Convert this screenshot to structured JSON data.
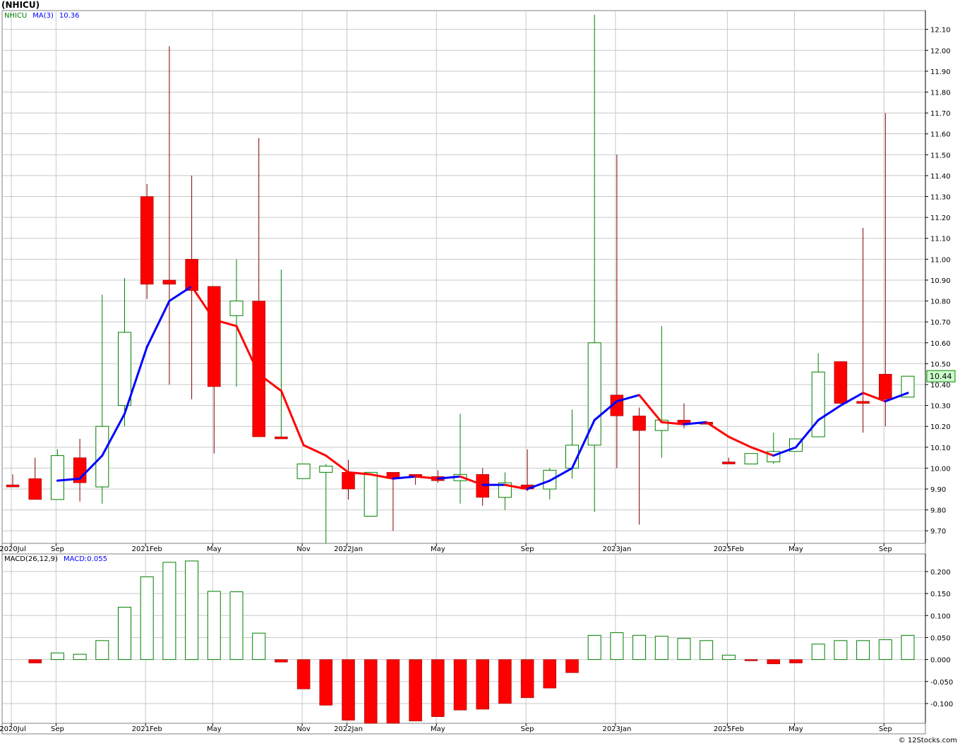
{
  "title": "(NHICU)",
  "credit": "© 12Stocks.com",
  "colors": {
    "up": "#008000",
    "down": "#ff0000",
    "ma_up": "#0000ff",
    "ma_down": "#ff0000",
    "grid": "#c8c8c8",
    "frame": "#808080",
    "price_label_bg": "#ccffcc"
  },
  "chart_data": [
    {
      "type": "candlestick",
      "symbol": "NHICU",
      "legend": {
        "symbol": "NHICU",
        "ma_label": "MA(3)",
        "ma_value": "10.36"
      },
      "last_price_label": "10.44",
      "y_ticks": [
        9.7,
        9.8,
        9.9,
        10.0,
        10.1,
        10.2,
        10.3,
        10.4,
        10.5,
        10.6,
        10.7,
        10.8,
        10.9,
        11.0,
        11.1,
        11.2,
        11.3,
        11.4,
        11.5,
        11.6,
        11.7,
        11.8,
        11.9,
        12.0,
        12.1
      ],
      "y_tick_labels": [
        "9.70",
        "9.80",
        "9.90",
        "10.00",
        "10.10",
        "10.20",
        "10.30",
        "10.40",
        "10.50",
        "10.60",
        "10.70",
        "10.80",
        "10.90",
        "11.00",
        "11.10",
        "11.20",
        "11.30",
        "11.40",
        "11.50",
        "11.60",
        "11.70",
        "11.80",
        "11.90",
        "12.00",
        "12.10"
      ],
      "ylim": [
        9.64,
        12.19
      ],
      "x_labels": [
        {
          "index": 0,
          "label": "2020Jul"
        },
        {
          "index": 2,
          "label": "Sep"
        },
        {
          "index": 6,
          "label": "2021Feb"
        },
        {
          "index": 9,
          "label": "May"
        },
        {
          "index": 13,
          "label": "Nov"
        },
        {
          "index": 15,
          "label": "2022Jan"
        },
        {
          "index": 19,
          "label": "May"
        },
        {
          "index": 23,
          "label": "Sep"
        },
        {
          "index": 27,
          "label": "2023Jan"
        },
        {
          "index": 32,
          "label": "2025Feb"
        },
        {
          "index": 35,
          "label": "May"
        },
        {
          "index": 39,
          "label": "Sep"
        }
      ],
      "candles": [
        {
          "o": 9.92,
          "h": 9.97,
          "l": 9.91,
          "c": 9.91
        },
        {
          "o": 9.95,
          "h": 10.05,
          "l": 9.85,
          "c": 9.85
        },
        {
          "o": 9.85,
          "h": 10.09,
          "l": 9.85,
          "c": 10.06
        },
        {
          "o": 10.05,
          "h": 10.14,
          "l": 9.84,
          "c": 9.93
        },
        {
          "o": 9.91,
          "h": 10.83,
          "l": 9.83,
          "c": 10.2
        },
        {
          "o": 10.3,
          "h": 10.91,
          "l": 10.2,
          "c": 10.65
        },
        {
          "o": 11.3,
          "h": 11.36,
          "l": 10.81,
          "c": 10.88
        },
        {
          "o": 10.9,
          "h": 12.02,
          "l": 10.4,
          "c": 10.88
        },
        {
          "o": 11.0,
          "h": 11.4,
          "l": 10.33,
          "c": 10.85
        },
        {
          "o": 10.87,
          "h": 10.87,
          "l": 10.07,
          "c": 10.39
        },
        {
          "o": 10.73,
          "h": 11.0,
          "l": 10.39,
          "c": 10.8
        },
        {
          "o": 10.8,
          "h": 11.58,
          "l": 10.15,
          "c": 10.15
        },
        {
          "o": 10.15,
          "h": 10.95,
          "l": 10.15,
          "c": 10.15
        },
        {
          "o": 9.95,
          "h": 10.02,
          "l": 9.95,
          "c": 10.02
        },
        {
          "o": 9.98,
          "h": 10.02,
          "l": 9.64,
          "c": 10.01
        },
        {
          "o": 9.98,
          "h": 10.04,
          "l": 9.85,
          "c": 9.9
        },
        {
          "o": 9.77,
          "h": 9.98,
          "l": 9.77,
          "c": 9.98
        },
        {
          "o": 9.98,
          "h": 9.98,
          "l": 9.7,
          "c": 9.95
        },
        {
          "o": 9.97,
          "h": 9.97,
          "l": 9.92,
          "c": 9.96
        },
        {
          "o": 9.96,
          "h": 9.99,
          "l": 9.93,
          "c": 9.94
        },
        {
          "o": 9.94,
          "h": 10.26,
          "l": 9.83,
          "c": 9.97
        },
        {
          "o": 9.97,
          "h": 10.0,
          "l": 9.82,
          "c": 9.86
        },
        {
          "o": 9.86,
          "h": 9.98,
          "l": 9.8,
          "c": 9.93
        },
        {
          "o": 9.92,
          "h": 10.09,
          "l": 9.89,
          "c": 9.9
        },
        {
          "o": 9.9,
          "h": 10.0,
          "l": 9.85,
          "c": 9.99
        },
        {
          "o": 10.0,
          "h": 10.28,
          "l": 9.95,
          "c": 10.11
        },
        {
          "o": 10.11,
          "h": 12.17,
          "l": 9.79,
          "c": 10.6
        },
        {
          "o": 10.35,
          "h": 11.5,
          "l": 10.0,
          "c": 10.25
        },
        {
          "o": 10.25,
          "h": 10.29,
          "l": 9.73,
          "c": 10.18
        },
        {
          "o": 10.18,
          "h": 10.68,
          "l": 10.05,
          "c": 10.23
        },
        {
          "o": 10.23,
          "h": 10.31,
          "l": 10.19,
          "c": 10.21
        },
        {
          "o": 10.22,
          "h": 10.22,
          "l": 10.22,
          "c": 10.22
        },
        {
          "o": 10.03,
          "h": 10.05,
          "l": 10.02,
          "c": 10.02
        },
        {
          "o": 10.02,
          "h": 10.07,
          "l": 10.02,
          "c": 10.07
        },
        {
          "o": 10.03,
          "h": 10.17,
          "l": 10.02,
          "c": 10.08
        },
        {
          "o": 10.08,
          "h": 10.14,
          "l": 10.08,
          "c": 10.14
        },
        {
          "o": 10.15,
          "h": 10.55,
          "l": 10.15,
          "c": 10.46
        },
        {
          "o": 10.51,
          "h": 10.51,
          "l": 10.31,
          "c": 10.31
        },
        {
          "o": 10.32,
          "h": 11.15,
          "l": 10.17,
          "c": 10.31
        },
        {
          "o": 10.45,
          "h": 11.7,
          "l": 10.2,
          "c": 10.33
        },
        {
          "o": 10.34,
          "h": 10.44,
          "l": 10.34,
          "c": 10.44
        }
      ],
      "ma": [
        null,
        null,
        9.94,
        9.95,
        10.06,
        10.26,
        10.58,
        10.8,
        10.87,
        10.71,
        10.68,
        10.45,
        10.37,
        10.11,
        10.06,
        9.98,
        9.97,
        9.95,
        9.96,
        9.95,
        9.96,
        9.92,
        9.92,
        9.9,
        9.94,
        10.0,
        10.23,
        10.32,
        10.35,
        10.22,
        10.21,
        10.22,
        10.15,
        10.1,
        10.06,
        10.1,
        10.23,
        10.3,
        10.36,
        10.32,
        10.36
      ]
    },
    {
      "type": "bar",
      "legend": {
        "label": "MACD(26,12,9)",
        "value_label": "MACD:0.055"
      },
      "y_ticks": [
        -0.1,
        -0.05,
        0.0,
        0.05,
        0.1,
        0.15,
        0.2
      ],
      "y_tick_labels": [
        "-0.100",
        "-0.050",
        "0.000",
        "0.050",
        "0.100",
        "0.150",
        "0.200"
      ],
      "ylim": [
        -0.145,
        0.24
      ],
      "x_labels": [
        {
          "index": 0,
          "label": "2020Jul"
        },
        {
          "index": 2,
          "label": "Sep"
        },
        {
          "index": 6,
          "label": "2021Feb"
        },
        {
          "index": 9,
          "label": "May"
        },
        {
          "index": 13,
          "label": "Nov"
        },
        {
          "index": 15,
          "label": "2022Jan"
        },
        {
          "index": 19,
          "label": "May"
        },
        {
          "index": 23,
          "label": "Sep"
        },
        {
          "index": 27,
          "label": "2023Jan"
        },
        {
          "index": 32,
          "label": "2025Feb"
        },
        {
          "index": 35,
          "label": "May"
        },
        {
          "index": 39,
          "label": "Sep"
        }
      ],
      "values": [
        null,
        -0.008,
        0.015,
        0.012,
        0.043,
        0.119,
        0.188,
        0.221,
        0.224,
        0.155,
        0.154,
        0.06,
        -0.006,
        -0.067,
        -0.104,
        -0.138,
        -0.145,
        -0.145,
        -0.14,
        -0.13,
        -0.115,
        -0.113,
        -0.1,
        -0.087,
        -0.065,
        -0.03,
        0.055,
        0.061,
        0.055,
        0.053,
        0.048,
        0.043,
        0.01,
        -0.003,
        -0.01,
        -0.008,
        0.035,
        0.043,
        0.043,
        0.045,
        0.055
      ]
    }
  ]
}
